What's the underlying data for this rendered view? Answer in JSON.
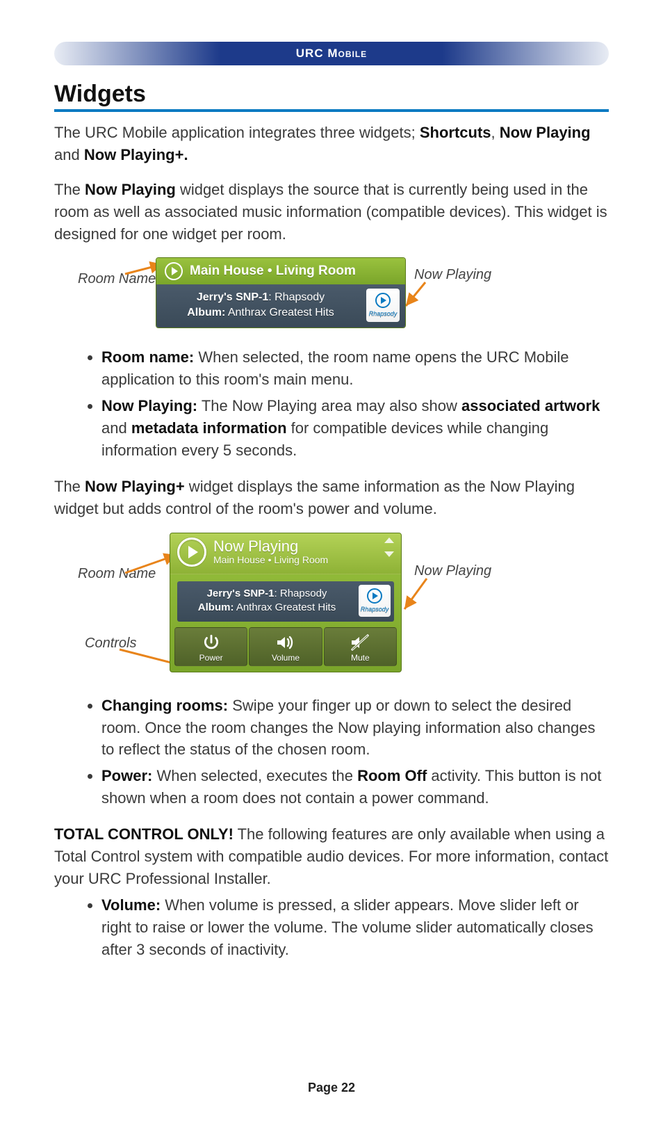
{
  "header": {
    "brand": "URC",
    "brand_suffix": "Mobile"
  },
  "title": "Widgets",
  "intro": {
    "pre": "The URC Mobile application integrates three widgets; ",
    "w1": "Shortcuts",
    "sep1": ", ",
    "w2": "Now Playing",
    "mid": " and ",
    "w3": "Now Playing+."
  },
  "para_np": {
    "pre": "The ",
    "bold": "Now Playing",
    "post": " widget displays the source that is currently being used in the room as well as associated music information (compatible devices). This widget is designed for one widget per room."
  },
  "widget1": {
    "room": "Main House • Living Room",
    "source_name": "Jerry's SNP-1",
    "source_sep": ": ",
    "source_service": "Rhapsody",
    "album_label": "Album:",
    "album_value": "Anthrax Greatest Hits",
    "art_label": "Rhapsody"
  },
  "annos1": {
    "room": "Room Name",
    "np": "Now Playing"
  },
  "bullets1": {
    "a_label": "Room name:",
    "a_text": " When selected, the room name opens the URC Mobile application to this room's main menu.",
    "b_label": "Now Playing:",
    "b_pre": " The Now Playing area may also show ",
    "b_b1": "associated artwork",
    "b_mid": " and ",
    "b_b2": "metadata information",
    "b_post": " for compatible devices while changing information every 5 seconds."
  },
  "para_npp": {
    "pre": "The ",
    "bold": "Now Playing+",
    "post": " widget displays the same information as the Now Playing widget but adds control of the room's power and volume."
  },
  "widget2": {
    "title": "Now Playing",
    "subtitle": "Main House • Living Room",
    "source_name": "Jerry's SNP-1",
    "source_sep": ": ",
    "source_service": "Rhapsody",
    "album_label": "Album:",
    "album_value": "Anthrax Greatest Hits",
    "art_label": "Rhapsody",
    "btn_power": "Power",
    "btn_volume": "Volume",
    "btn_mute": "Mute"
  },
  "annos2": {
    "room": "Room Name",
    "np": "Now Playing",
    "controls": "Controls"
  },
  "bullets2": {
    "a_label": "Changing rooms:",
    "a_text": " Swipe your finger up or down to select the desired room.  Once the room changes the Now playing information also changes to reflect the status of the chosen room.",
    "b_label": "Power:",
    "b_pre": " When selected, executes the ",
    "b_b1": "Room Off",
    "b_post": " activity. This button is not shown when a room does not contain a power command."
  },
  "tco": {
    "label": "TOTAL CONTROL ONLY!",
    "text": " The following features are only available when using a Total Control system with compatible audio devices. For more information, contact your URC Professional Installer."
  },
  "bullets3": {
    "a_label": "Volume:",
    "a_text": " When volume is pressed, a slider appears.  Move slider left or right to raise or lower the volume.  The volume slider automatically closes after 3 seconds of inactivity."
  },
  "footer": "Page 22"
}
